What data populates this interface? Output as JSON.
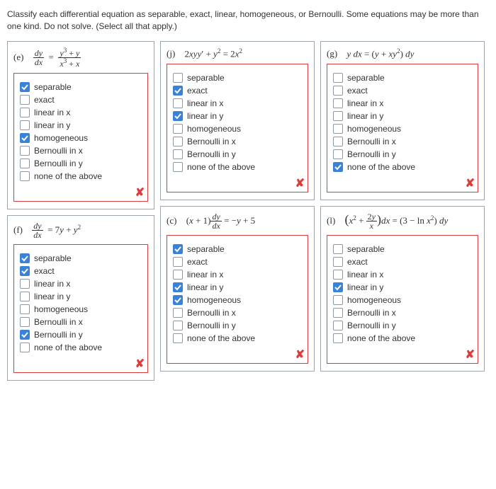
{
  "instructions": "Classify each differential equation as separable, exact, linear, homogeneous, or Bernoulli. Some equations may be more than one kind. Do not solve. (Select all that apply.)",
  "options": {
    "separable": "separable",
    "exact": "exact",
    "linear_x": "linear in x",
    "linear_y": "linear in y",
    "homogeneous": "homogeneous",
    "bernoulli_x": "Bernoulli in x",
    "bernoulli_y": "Bernoulli in y",
    "none": "none of the above"
  },
  "problems": {
    "e": {
      "letter": "(e)"
    },
    "f": {
      "letter": "(f)"
    },
    "j": {
      "letter": "(j)"
    },
    "c": {
      "letter": "(c)"
    },
    "g": {
      "letter": "(g)"
    },
    "l": {
      "letter": "(l)"
    }
  }
}
